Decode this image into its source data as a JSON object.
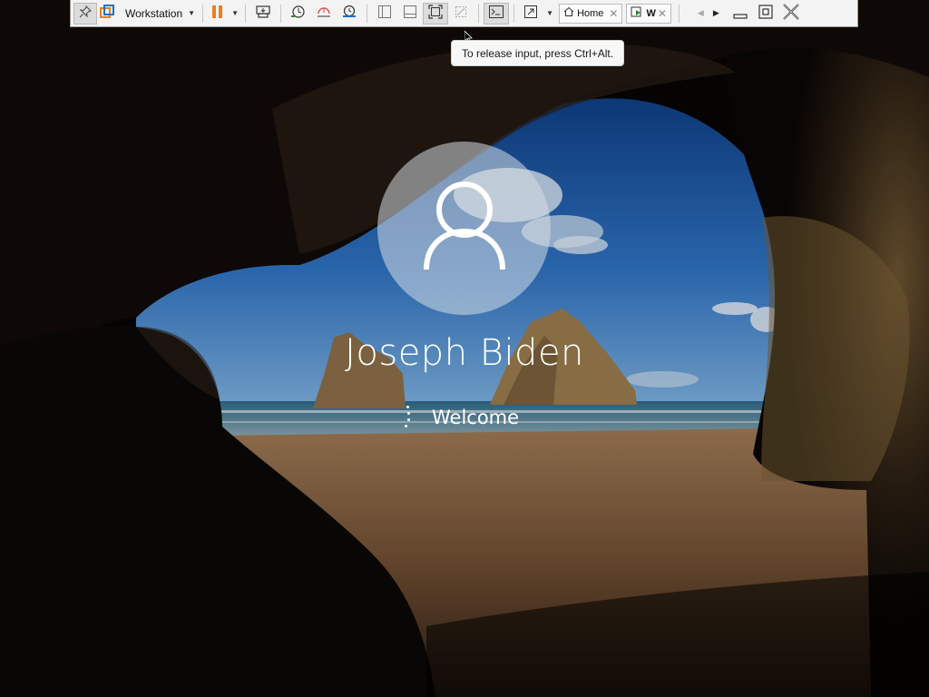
{
  "toolbar": {
    "vm_menu_label": "Workstation",
    "tabs": [
      {
        "label": "Home",
        "icon": "home-icon"
      },
      {
        "label": "W",
        "icon": "vm-running-icon"
      }
    ]
  },
  "tooltip": {
    "text": "To release input, press Ctrl+Alt."
  },
  "login": {
    "user_name": "Joseph Biden",
    "status_text": "Welcome"
  },
  "colors": {
    "accent_orange": "#f07d1a",
    "vmware_blue": "#1a73c9",
    "toolbar_bg": "#f3f3f3"
  }
}
